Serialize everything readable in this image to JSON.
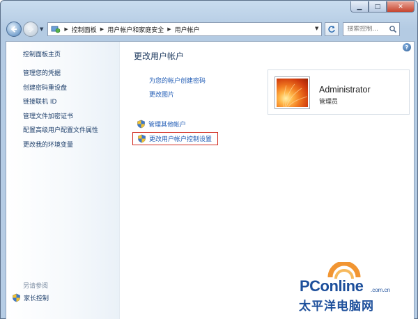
{
  "window": {
    "buttons": {
      "minimize": "▁",
      "maximize": "□",
      "close": "✕"
    }
  },
  "nav": {
    "back_icon": "back-arrow-icon",
    "forward_icon": "forward-arrow-icon",
    "breadcrumb": [
      "控制面板",
      "用户帐户和家庭安全",
      "用户帐户"
    ],
    "search_placeholder": "搜索控制..."
  },
  "sidebar": {
    "home": "控制面板主页",
    "links": [
      "管理您的凭据",
      "创建密码重设盘",
      "链接联机 ID",
      "管理文件加密证书",
      "配置高级用户配置文件属性",
      "更改我的环境变量"
    ],
    "see_also_title": "另请参阅",
    "see_also_items": [
      "家长控制"
    ]
  },
  "main": {
    "title": "更改用户帐户",
    "links": [
      "为您的帐户创建密码",
      "更改图片"
    ],
    "tasks": [
      "管理其他帐户",
      "更改用户帐户控制设置"
    ],
    "help": "?"
  },
  "account": {
    "name": "Administrator",
    "role": "管理员"
  },
  "watermark": {
    "brand": "PConline",
    "domain": ".com.cn",
    "brand_cn": "太平洋电脑网"
  },
  "colors": {
    "link": "#1f5bb5",
    "highlight_border": "#d12b1f",
    "frame": "#b6cde5"
  }
}
